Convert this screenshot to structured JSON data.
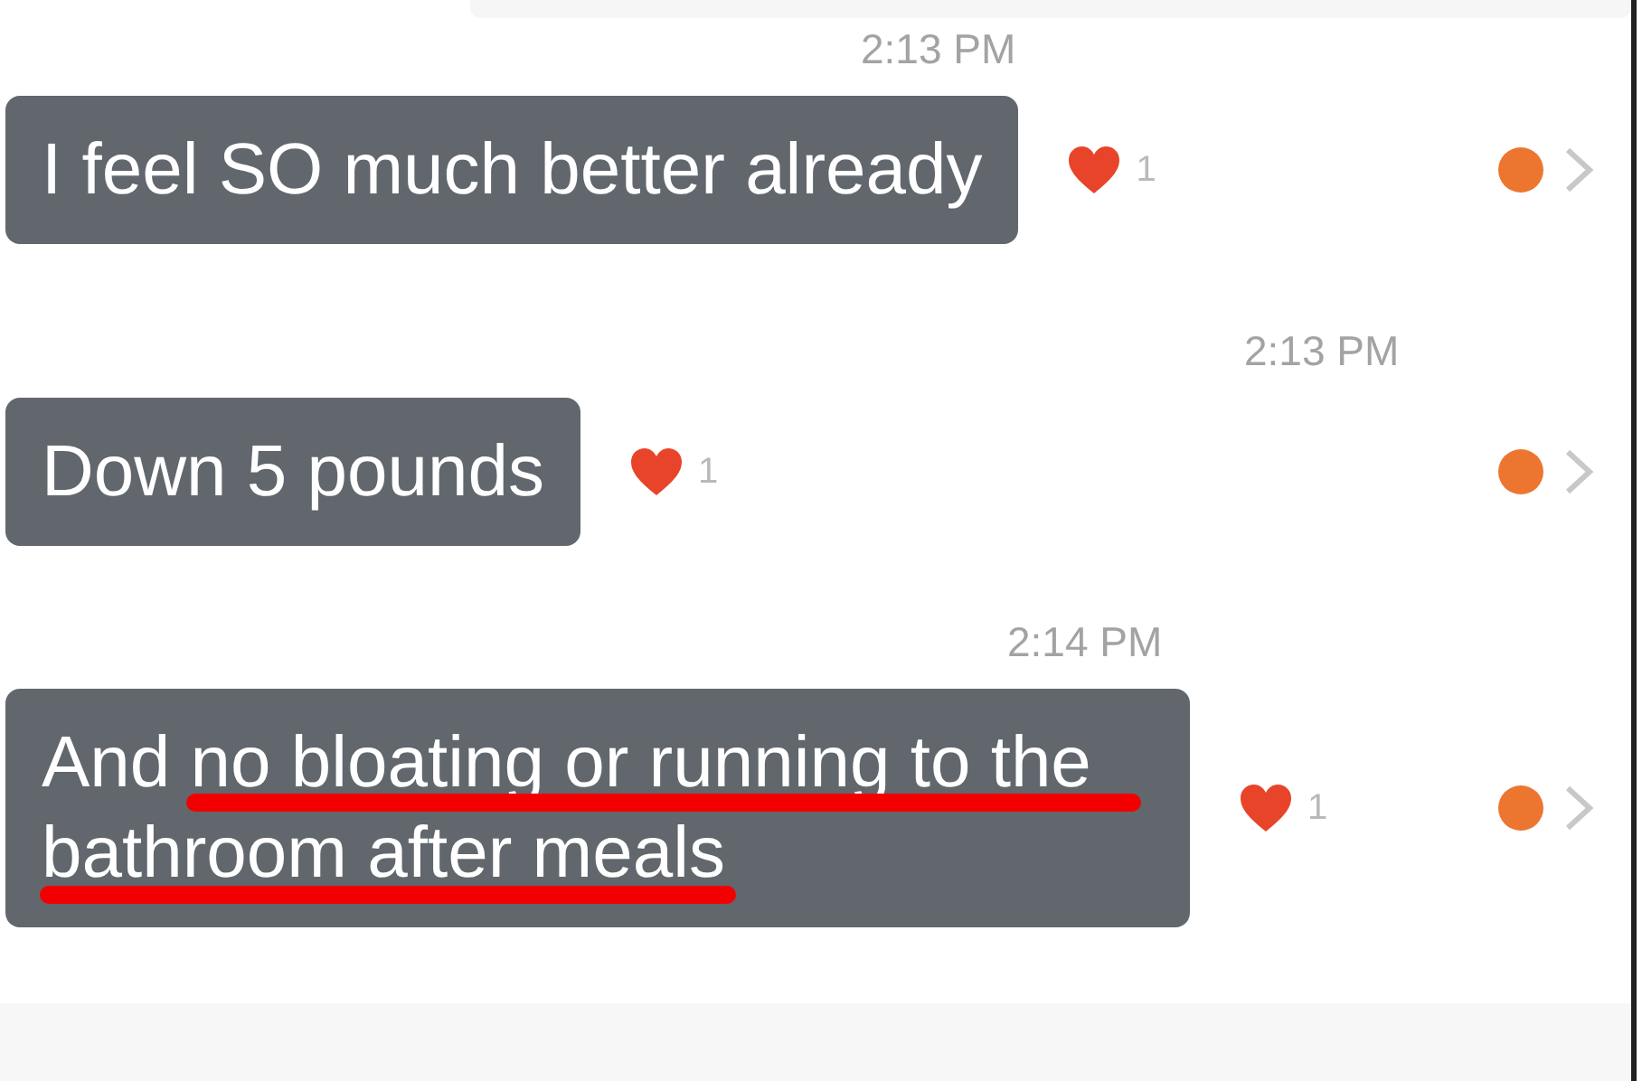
{
  "messages": [
    {
      "time": "2:13 PM",
      "text": "I feel SO much better already",
      "likes": "1",
      "liked": true,
      "underlined": false
    },
    {
      "time": "2:13 PM",
      "text": "Down 5 pounds",
      "likes": "1",
      "liked": true,
      "underlined": false
    },
    {
      "time": "2:14 PM",
      "text": "And no bloating or running to the bathroom after meals",
      "likes": "1",
      "liked": true,
      "underlined": true
    }
  ]
}
